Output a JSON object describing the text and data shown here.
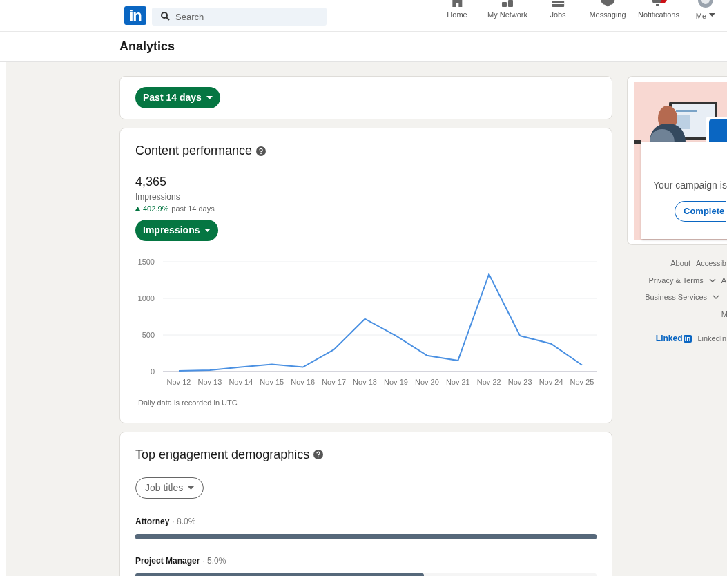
{
  "header": {
    "logo": "in",
    "search": {
      "placeholder": "Search"
    },
    "nav": [
      {
        "label": "Home",
        "kind": "home"
      },
      {
        "label": "My Network",
        "kind": "network"
      },
      {
        "label": "Jobs",
        "kind": "jobs"
      },
      {
        "label": "Messaging",
        "kind": "messaging"
      },
      {
        "label": "Notifications",
        "kind": "notifications"
      },
      {
        "label": "Me",
        "kind": "me"
      }
    ]
  },
  "page_title": "Analytics",
  "range_filter": "Past 14 days",
  "content_performance": {
    "title": "Content performance",
    "total": "4,365",
    "total_label": "Impressions",
    "change": "402.9%",
    "change_period": "past 14 days",
    "note": "Daily data is recorded in UTC",
    "chart_data": {
      "type": "line",
      "categories": [
        "Nov 12",
        "Nov 13",
        "Nov 14",
        "Nov 15",
        "Nov 16",
        "Nov 17",
        "Nov 18",
        "Nov 19",
        "Nov 20",
        "Nov 21",
        "Nov 22",
        "Nov 23",
        "Nov 24",
        "Nov 25"
      ],
      "series": [
        {
          "name": "Impressions",
          "color": "#4a90e2",
          "values": [
            10,
            20,
            60,
            100,
            60,
            300,
            720,
            490,
            220,
            150,
            1330,
            490,
            380,
            90
          ]
        }
      ],
      "ylim": [
        0,
        1500
      ],
      "yticks": [
        0,
        500,
        1000,
        1500
      ]
    }
  },
  "demographics": {
    "title": "Top engagement demographics",
    "filter": "Job titles",
    "rows": [
      {
        "label": "Attorney",
        "value": "· 8.0%",
        "level": 1.0
      },
      {
        "label": "Project Manager",
        "value": "· 5.0%",
        "level": 0.625
      }
    ]
  },
  "promo": {
    "text": "Your campaign is",
    "button": "Complete"
  },
  "footer": {
    "links": [
      [
        "About",
        "Accessib"
      ],
      [
        "Privacy & Terms",
        "A"
      ],
      [
        "Business Services"
      ],
      [
        "M"
      ]
    ],
    "brand_word": "Linked",
    "brand_badge": "in",
    "brand_text": "LinkedIn"
  }
}
